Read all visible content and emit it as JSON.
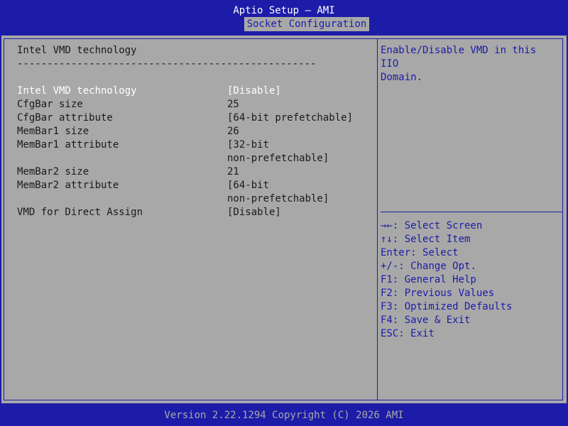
{
  "header": {
    "title": "Aptio Setup – AMI",
    "active_tab": "Socket Configuration"
  },
  "section": {
    "heading": "Intel VMD technology",
    "separator": "--------------------------------------------------"
  },
  "settings": [
    {
      "label": "Intel VMD technology",
      "value": [
        "[Disable]"
      ],
      "selected": true
    },
    {
      "label": "CfgBar size",
      "value": [
        "25"
      ]
    },
    {
      "label": "CfgBar attribute",
      "value": [
        "[64-bit prefetchable]"
      ]
    },
    {
      "label": "MemBar1 size",
      "value": [
        "26"
      ]
    },
    {
      "label": "MemBar1 attribute",
      "value": [
        "[32-bit",
        "non-prefetchable]"
      ]
    },
    {
      "label": "MemBar2 size",
      "value": [
        "21"
      ]
    },
    {
      "label": "MemBar2 attribute",
      "value": [
        "[64-bit",
        "non-prefetchable]"
      ]
    },
    {
      "label": "VMD for Direct Assign",
      "value": [
        "[Disable]"
      ]
    }
  ],
  "help": {
    "lines": [
      "Enable/Disable VMD in this IIO",
      "Domain."
    ]
  },
  "keys": [
    {
      "key": "→←",
      "desc": ": Select Screen"
    },
    {
      "key": "↑↓",
      "desc": ": Select Item"
    },
    {
      "key": "Enter",
      "desc": ": Select"
    },
    {
      "key": "+/-",
      "desc": ": Change Opt."
    },
    {
      "key": "F1",
      "desc": ": General Help"
    },
    {
      "key": "F2",
      "desc": ": Previous Values"
    },
    {
      "key": "F3",
      "desc": ": Optimized Defaults"
    },
    {
      "key": "F4",
      "desc": ": Save & Exit"
    },
    {
      "key": "ESC",
      "desc": ": Exit"
    }
  ],
  "footer": {
    "text": "Version 2.22.1294 Copyright (C) 2026 AMI"
  },
  "colors": {
    "background": "#1c1ca8",
    "panel": "#a8a8a8",
    "text": "#1a1a1a",
    "highlight": "#ffffff"
  }
}
